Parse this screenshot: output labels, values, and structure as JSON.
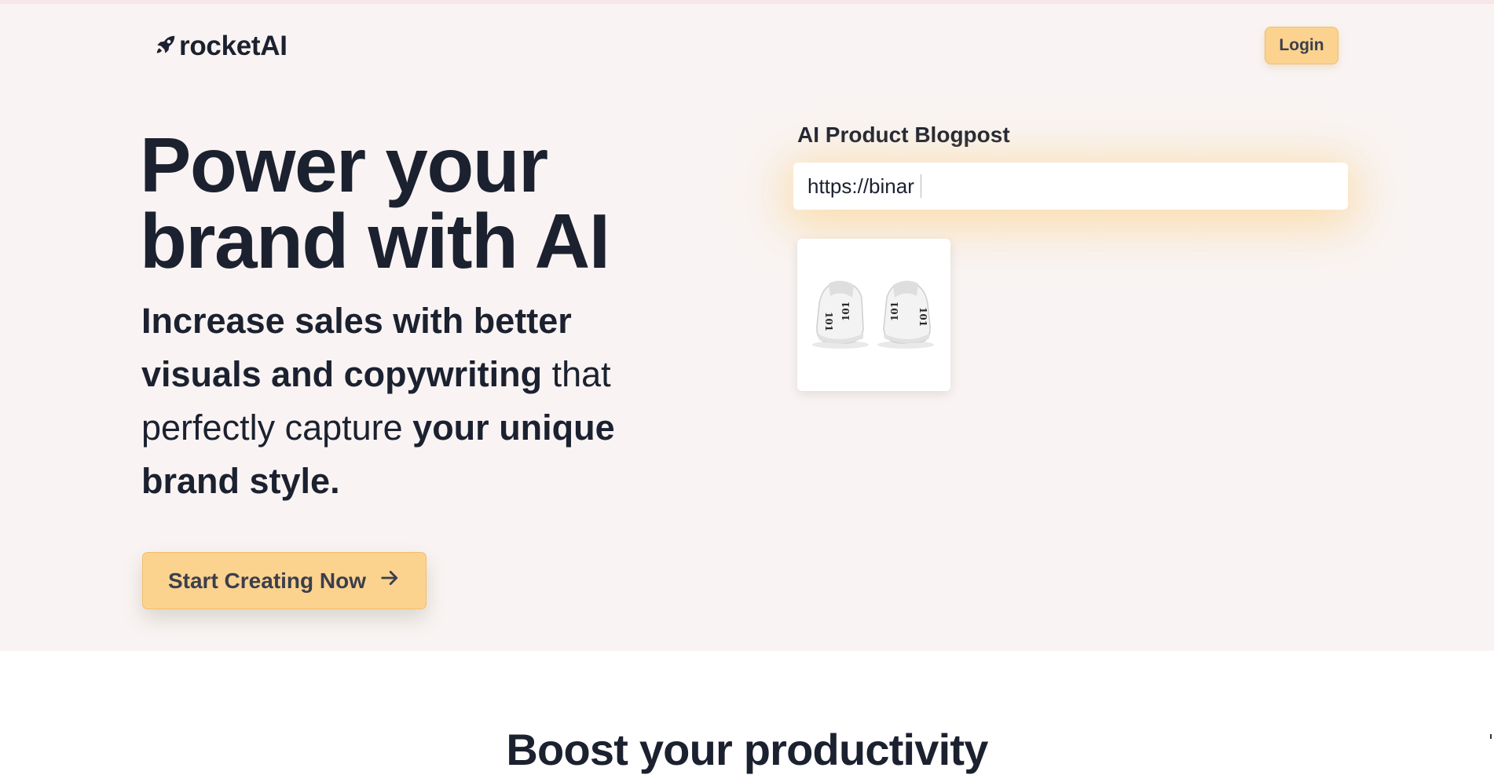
{
  "header": {
    "brand": "rocketAI",
    "brand_icon": "rocket-icon",
    "login_label": "Login"
  },
  "hero": {
    "headline": "Power your brand with AI",
    "subheadline_parts": {
      "p1": "Increase sales with better visuals and copywriting",
      "p2": " that perfectly capture ",
      "p3": "your unique brand style."
    },
    "cta_label": "Start Creating Now",
    "cta_icon": "arrow-right-icon"
  },
  "demo": {
    "title": "AI Product Blogpost",
    "url_value": "https://binar",
    "product_image": "white-sneakers-image"
  },
  "section2": {
    "title": "Boost your productivity"
  },
  "colors": {
    "hero_bg": "#f9f4f3",
    "accent": "#fcd28f",
    "text": "#1c2130"
  }
}
